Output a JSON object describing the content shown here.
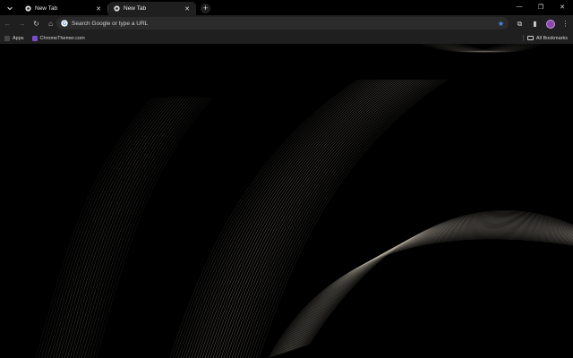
{
  "tabs": [
    {
      "title": "New Tab",
      "close": "✕",
      "active": false
    },
    {
      "title": "New Tab",
      "close": "✕",
      "active": true
    }
  ],
  "new_tab_label": "+",
  "window_controls": {
    "minimize": "—",
    "maximize": "❐",
    "close": "✕"
  },
  "toolbar": {
    "back": "←",
    "forward": "→",
    "reload": "↻",
    "home": "⌂",
    "star": "★",
    "extensions": "⧉",
    "sidepanel": "▮",
    "menu": "⋮"
  },
  "omnibox": {
    "placeholder": "Search Google or type a URL",
    "value": ""
  },
  "bookmarks": {
    "apps_label": "Apps",
    "items": [
      {
        "label": "ChromeThemer.com"
      }
    ],
    "all_bookmarks_label": "All Bookmarks"
  },
  "theme": {
    "line_color": "#bfb7a8",
    "background": "#000000",
    "accent": "#4d8ff3"
  }
}
